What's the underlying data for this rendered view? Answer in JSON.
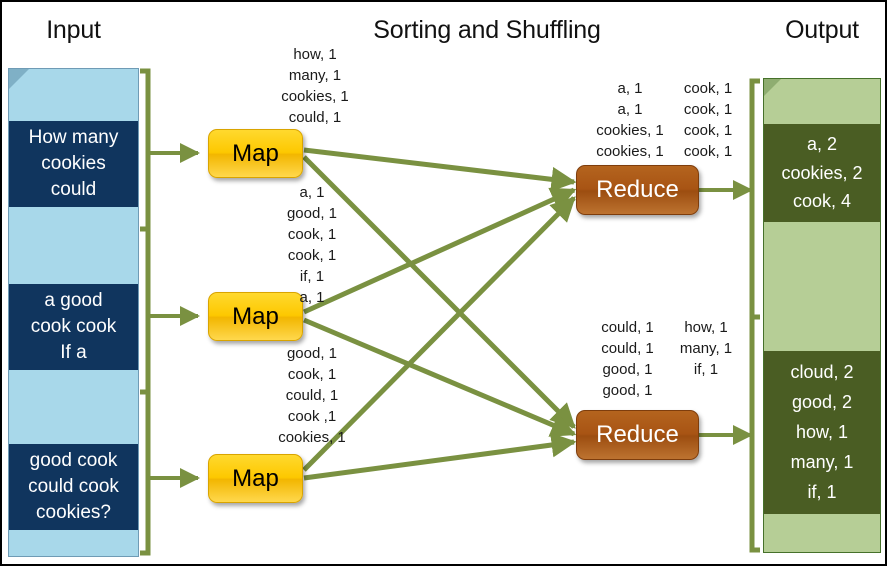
{
  "headers": {
    "input": "Input",
    "middle": "Sorting and Shuffling",
    "output": "Output"
  },
  "colors": {
    "input_doc": "#a8d8ea",
    "input_band": "#10355e",
    "output_doc": "#b6ce96",
    "output_band": "#4a5d23",
    "map_node": "#fdc800",
    "reduce_node": "#a85414",
    "connector": "#7a9141",
    "page_border": "#000000"
  },
  "input_document": {
    "bands": [
      {
        "text": "How many\ncookies\ncould"
      },
      {
        "text": "a good\ncook cook\nIf a"
      },
      {
        "text": "good cook\ncould cook\ncookies?"
      }
    ]
  },
  "nodes": {
    "map_label": "Map",
    "reduce_label": "Reduce",
    "maps": [
      {
        "label": "Map"
      },
      {
        "label": "Map"
      },
      {
        "label": "Map"
      }
    ],
    "reduces": [
      {
        "label": "Reduce"
      },
      {
        "label": "Reduce"
      }
    ]
  },
  "map_outputs": [
    {
      "lines": "how, 1\nmany, 1\ncookies, 1\ncould, 1"
    },
    {
      "lines": "a, 1\ngood, 1\ncook, 1\ncook, 1\nif, 1\na, 1"
    },
    {
      "lines": "good, 1\ncook, 1\ncould, 1\ncook ,1\ncookies, 1"
    }
  ],
  "shuffle_groups": [
    {
      "left_column": "a, 1\na, 1\ncookies, 1\ncookies, 1",
      "right_column": "cook, 1\ncook, 1\ncook, 1\ncook, 1"
    },
    {
      "left_column": "could, 1\ncould, 1\ngood, 1\ngood, 1",
      "right_column": "how, 1\nmany, 1\nif, 1"
    }
  ],
  "output_document": {
    "bands": [
      {
        "lines": [
          "a, 2",
          "cookies, 2",
          "cook, 4"
        ]
      },
      {
        "lines": [
          "cloud, 2",
          "good, 2",
          "how, 1",
          "many, 1",
          "if, 1"
        ]
      }
    ]
  }
}
